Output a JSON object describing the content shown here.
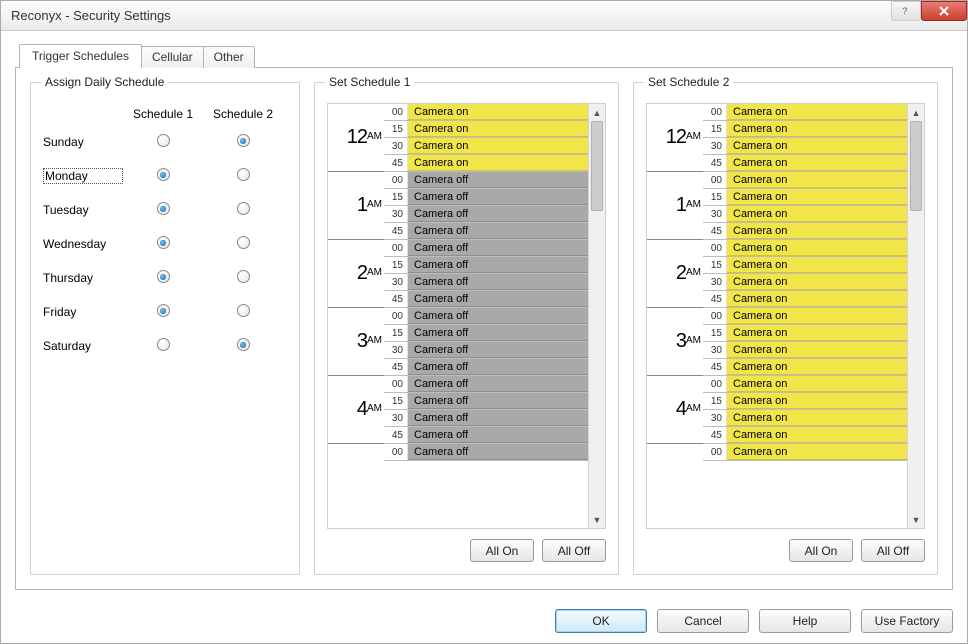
{
  "window": {
    "title": "Reconyx - Security Settings"
  },
  "tabs": [
    {
      "label": "Trigger Schedules",
      "active": true
    },
    {
      "label": "Cellular",
      "active": false
    },
    {
      "label": "Other",
      "active": false
    }
  ],
  "assign": {
    "legend": "Assign Daily Schedule",
    "col1": "Schedule 1",
    "col2": "Schedule 2",
    "days": [
      {
        "name": "Sunday",
        "selected": 2
      },
      {
        "name": "Monday",
        "selected": 1,
        "focused": true
      },
      {
        "name": "Tuesday",
        "selected": 1
      },
      {
        "name": "Wednesday",
        "selected": 1
      },
      {
        "name": "Thursday",
        "selected": 1
      },
      {
        "name": "Friday",
        "selected": 1
      },
      {
        "name": "Saturday",
        "selected": 2
      }
    ]
  },
  "minutes": [
    "00",
    "15",
    "30",
    "45"
  ],
  "status": {
    "on": "Camera on",
    "off": "Camera off"
  },
  "schedule1": {
    "legend": "Set Schedule 1",
    "hours": [
      {
        "label": "12",
        "ampm": "AM",
        "slots": [
          "on",
          "on",
          "on",
          "on"
        ]
      },
      {
        "label": "1",
        "ampm": "AM",
        "slots": [
          "off",
          "off",
          "off",
          "off"
        ]
      },
      {
        "label": "2",
        "ampm": "AM",
        "slots": [
          "off",
          "off",
          "off",
          "off"
        ]
      },
      {
        "label": "3",
        "ampm": "AM",
        "slots": [
          "off",
          "off",
          "off",
          "off"
        ]
      },
      {
        "label": "4",
        "ampm": "AM",
        "slots": [
          "off",
          "off",
          "off",
          "off"
        ]
      }
    ],
    "extra": [
      {
        "min": "00",
        "state": "off"
      }
    ]
  },
  "schedule2": {
    "legend": "Set Schedule 2",
    "hours": [
      {
        "label": "12",
        "ampm": "AM",
        "slots": [
          "on",
          "on",
          "on",
          "on"
        ]
      },
      {
        "label": "1",
        "ampm": "AM",
        "slots": [
          "on",
          "on",
          "on",
          "on"
        ]
      },
      {
        "label": "2",
        "ampm": "AM",
        "slots": [
          "on",
          "on",
          "on",
          "on"
        ]
      },
      {
        "label": "3",
        "ampm": "AM",
        "slots": [
          "on",
          "on",
          "on",
          "on"
        ]
      },
      {
        "label": "4",
        "ampm": "AM",
        "slots": [
          "on",
          "on",
          "on",
          "on"
        ]
      }
    ],
    "extra": [
      {
        "min": "00",
        "state": "on"
      }
    ]
  },
  "buttons": {
    "all_on": "All On",
    "all_off": "All Off",
    "ok": "OK",
    "cancel": "Cancel",
    "help": "Help",
    "use_factory": "Use Factory"
  },
  "colors": {
    "on": "#f0e64a",
    "off": "#a9a9a9",
    "accent_radio": "#2a7abf"
  }
}
